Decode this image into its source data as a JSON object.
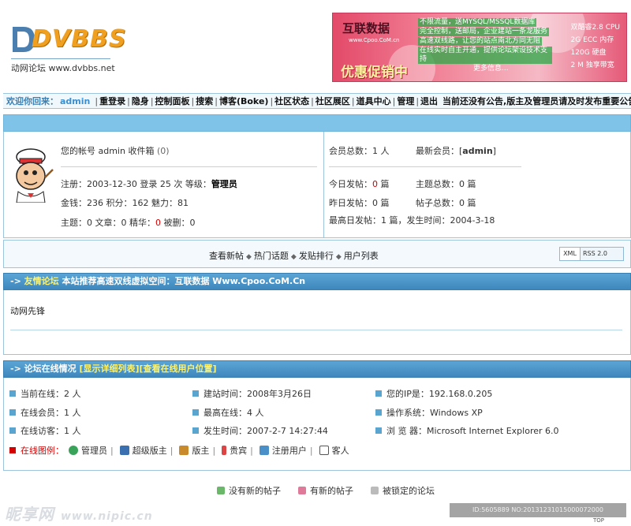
{
  "header": {
    "logo_text": "DVBBS",
    "logo_sub": "动网论坛 www.dvbbs.net"
  },
  "banner": {
    "title": "互联数据",
    "site": "www.Cpoo.CoM.cn",
    "promo": "优惠促销中",
    "lines": [
      "不限流量，送MYSQL/MSSQL数据库",
      "完全控制，送邮局，企业建站一条龙服务",
      "高速双线路，让您的站点南北方同无阻",
      "在线实时自主开通，提供论坛架设技术支持",
      "更多信息..."
    ],
    "specs": [
      "双酷睿2.8 CPU",
      "2G ECC 内存",
      "120G 硬盘",
      "2 M 独享带宽"
    ]
  },
  "nav": {
    "welcome": "欢迎你回来：",
    "user": "admin",
    "items": [
      "重登录",
      "隐身",
      "控制面板",
      "搜索",
      "博客(Boke)",
      "社区状态",
      "社区展区",
      "道具中心",
      "管理",
      "退出"
    ],
    "notice": "当前还没有公告,版主及管理员请及时发布重要公告![聚集社区]("
  },
  "user_panel": {
    "account": "您的帐号 admin 收件箱",
    "inbox_count": "(0)",
    "reg_prefix": "注册：2003-12-30 登录 25 次 等级：",
    "level": "管理员",
    "money": "金钱：236 积分：162 魅力：81",
    "topics_prefix": "主题：0 文章：0 精华：",
    "essence": "0",
    "deleted": " 被删：0"
  },
  "stats": {
    "members_label": "会员总数：1 人",
    "newest_label": "最新会员：[",
    "newest_user": "admin",
    "newest_close": "]",
    "today_prefix": "今日发帖：",
    "today_val": "0",
    "unit": " 篇",
    "topics_total": "主题总数：0 篇",
    "yesterday_prefix": "昨日发帖：",
    "yesterday_val": "0",
    "posts_total": "帖子总数：0 篇",
    "max_day": "最高日发帖：1 篇，发生时间：2004-3-18"
  },
  "quick_links": [
    "查看新帖",
    "热门话题",
    "发贴排行",
    "用户列表"
  ],
  "rss": {
    "xml": "XML",
    "rss2": "RSS 2.0"
  },
  "friend_section": {
    "title_prefix": "-> ",
    "title": "友情论坛",
    "text": " 本站推荐高速双线虚拟空间：互联数据 Www.Cpoo.CoM.Cn",
    "content": "动网先锋"
  },
  "online_section": {
    "title_prefix": "-> ",
    "title": "论坛在线情况",
    "link1": "[显示详细列表]",
    "link2": "[查看在线用户位置]",
    "items": [
      "当前在线：2 人",
      "建站时间：2008年3月26日",
      "您的IP是：192.168.0.205",
      "在线会员：1 人",
      "最高在线：4 人",
      "操作系统：Windows XP",
      "在线访客：1 人",
      "发生时间：2007-2-7 14:27:44",
      "浏 览 器：Microsoft Internet Explorer 6.0"
    ],
    "legend_label": "在线图例：",
    "legend": [
      "管理员",
      "超级版主",
      "版主",
      "贵宾",
      "注册用户",
      "客人"
    ]
  },
  "footer": {
    "items": [
      "没有新的帖子",
      "有新的帖子",
      "被锁定的论坛"
    ]
  },
  "watermark": {
    "left": "昵享网",
    "url": "www.nipic.cn",
    "id": "ID:5605889 NO:20131231015000072000",
    "top": "TOP"
  },
  "colors": {
    "accent": "#3a7fb2",
    "bar": "#7fc3e8",
    "border": "#9cc4dc",
    "red": "#d40000"
  }
}
